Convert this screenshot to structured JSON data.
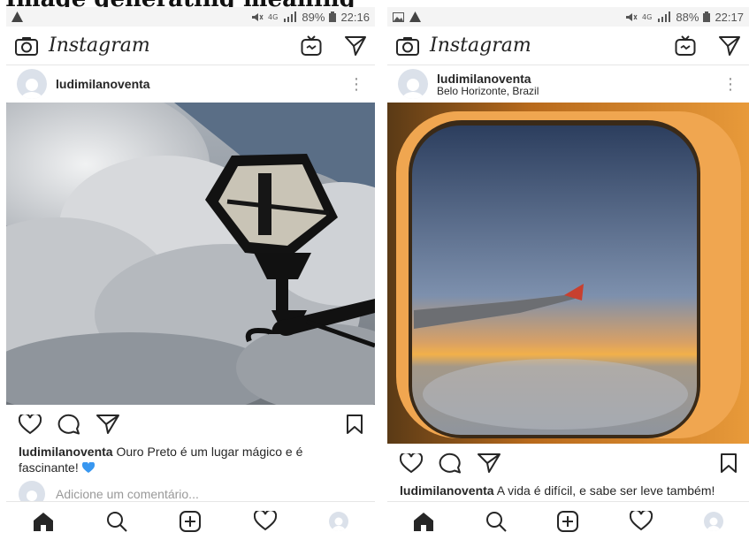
{
  "top_caption": "Image generating meaning",
  "colors": {
    "heart_blue": "#3897f0",
    "icon_dark": "#262626",
    "muted": "#8e8e8e",
    "bg": "#ffffff"
  },
  "left_phone": {
    "status": {
      "battery": "89%",
      "time": "22:16"
    },
    "app_title": "Instagram",
    "post": {
      "username": "ludimilanoventa",
      "location": "",
      "caption_user": "ludimilanoventa",
      "caption_text": " Ouro Preto é um lugar mágico e é fascinante!",
      "comment_placeholder": "Adicione um comentário..."
    }
  },
  "right_phone": {
    "status": {
      "battery": "88%",
      "time": "22:17"
    },
    "app_title": "Instagram",
    "post": {
      "username": "ludimilanoventa",
      "location": "Belo Horizonte, Brazil",
      "caption_user": "ludimilanoventa",
      "caption_text": " A vida é difícil, e sabe ser leve também!"
    }
  },
  "icons": [
    "camera-icon",
    "igtv-icon",
    "direct-icon",
    "heart-icon",
    "comment-icon",
    "share-icon",
    "bookmark-icon",
    "home-icon",
    "search-icon",
    "add-icon",
    "activity-icon",
    "profile-icon",
    "more-icon"
  ]
}
